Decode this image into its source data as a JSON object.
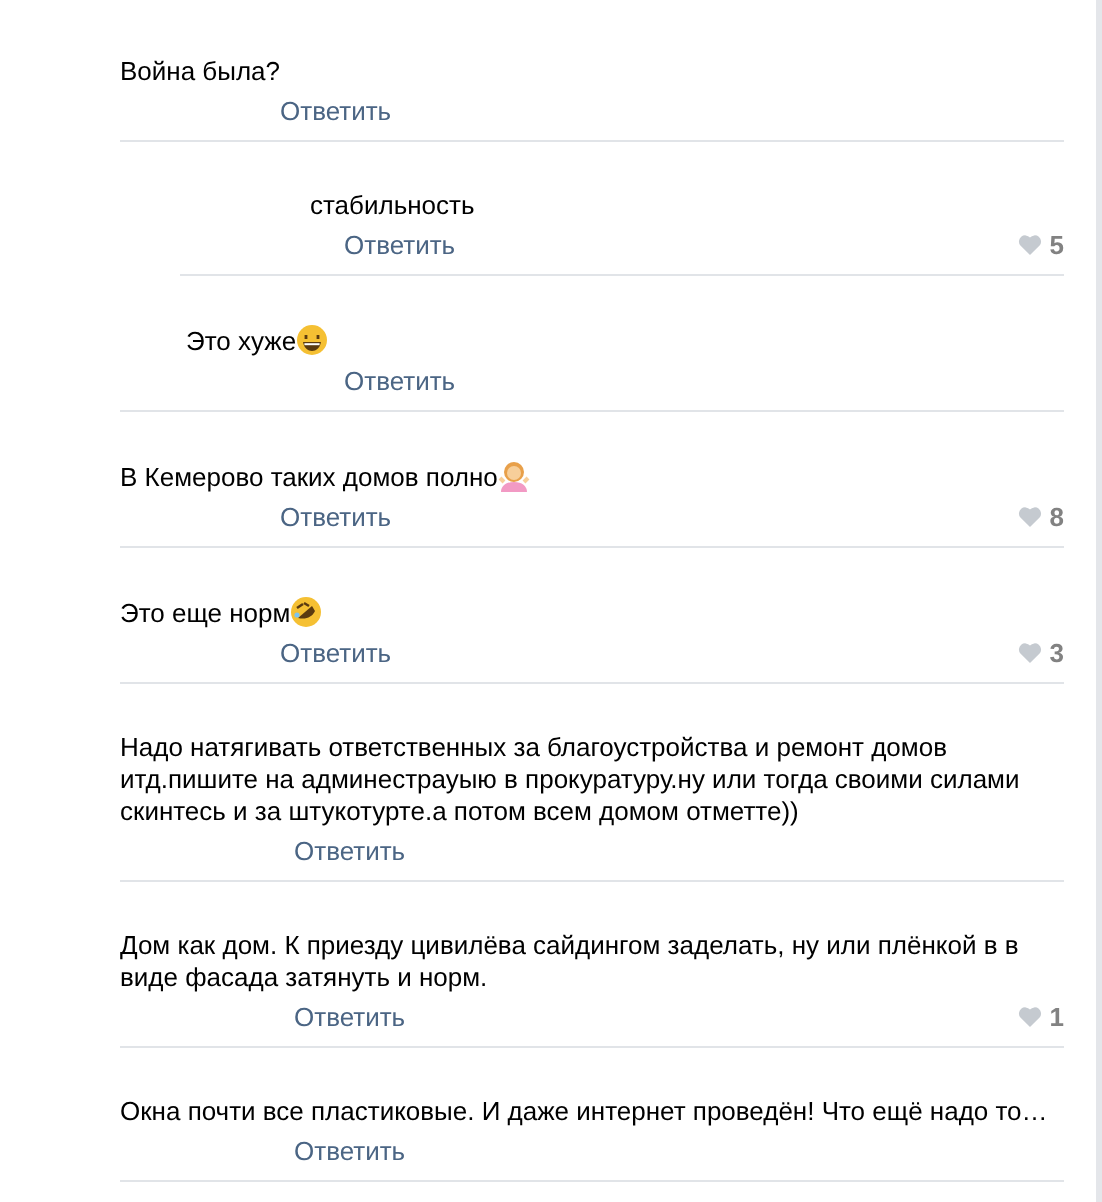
{
  "comments": [
    {
      "text": "Война была?",
      "reply": "Ответить"
    },
    {
      "text": "стабильность",
      "reply": "Ответить",
      "likes": "5"
    },
    {
      "text": "Это хуже",
      "kind": "grin",
      "reply": "Ответить"
    },
    {
      "text": "В Кемерово таких домов полно",
      "kind": "person",
      "reply": "Ответить",
      "likes": "8"
    },
    {
      "text": "Это еще норм",
      "kind": "rofl",
      "reply": "Ответить",
      "likes": "3"
    },
    {
      "text": "Надо натягивать ответственных за благоустройства и ремонт домов итд.пишите на админестрауыю в прокуратуру.ну или тогда своими силами скинтесь и за штукотурте.а потом всем домом отметте))",
      "reply": "Ответить"
    },
    {
      "text": "Дом как дом. К приезду цивилёва сайдингом заделать, ну или плёнкой в в виде фасада затянуть и норм.",
      "reply": "Ответить",
      "likes": "1"
    },
    {
      "text": "Окна почти все пластиковые. И даже интернет проведён! Что ещё надо то…",
      "reply": "Ответить"
    }
  ]
}
